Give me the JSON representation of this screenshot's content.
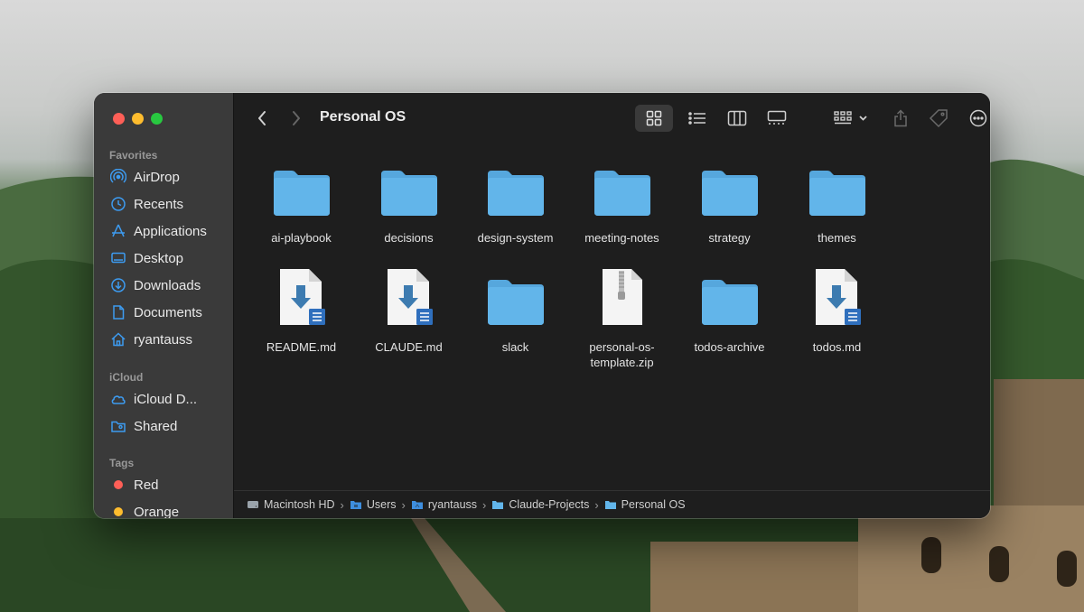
{
  "window": {
    "title": "Personal OS"
  },
  "sidebar": {
    "favorites_heading": "Favorites",
    "favorites": [
      {
        "label": "AirDrop",
        "icon": "airdrop-icon"
      },
      {
        "label": "Recents",
        "icon": "clock-icon"
      },
      {
        "label": "Applications",
        "icon": "applications-icon"
      },
      {
        "label": "Desktop",
        "icon": "desktop-icon"
      },
      {
        "label": "Downloads",
        "icon": "download-icon"
      },
      {
        "label": "Documents",
        "icon": "document-icon"
      },
      {
        "label": "ryantauss",
        "icon": "home-icon"
      }
    ],
    "icloud_heading": "iCloud",
    "icloud": [
      {
        "label": "iCloud D...",
        "icon": "cloud-icon"
      },
      {
        "label": "Shared",
        "icon": "shared-folder-icon"
      }
    ],
    "tags_heading": "Tags",
    "tags": [
      {
        "label": "Red",
        "color": "#ff5f57"
      },
      {
        "label": "Orange",
        "color": "#febc2e"
      }
    ]
  },
  "items": [
    {
      "name": "ai-playbook",
      "type": "folder"
    },
    {
      "name": "decisions",
      "type": "folder"
    },
    {
      "name": "design-system",
      "type": "folder"
    },
    {
      "name": "meeting-notes",
      "type": "folder"
    },
    {
      "name": "strategy",
      "type": "folder"
    },
    {
      "name": "themes",
      "type": "folder"
    },
    {
      "name": "README.md",
      "type": "markdown"
    },
    {
      "name": "CLAUDE.md",
      "type": "markdown"
    },
    {
      "name": "slack",
      "type": "folder"
    },
    {
      "name": "personal-os-template.zip",
      "type": "zip",
      "zip_label": "ZIP"
    },
    {
      "name": "todos-archive",
      "type": "folder"
    },
    {
      "name": "todos.md",
      "type": "markdown"
    }
  ],
  "pathbar": [
    {
      "label": "Macintosh HD",
      "icon": "disk-icon"
    },
    {
      "label": "Users",
      "icon": "folder-icon"
    },
    {
      "label": "ryantauss",
      "icon": "folder-icon"
    },
    {
      "label": "Claude-Projects",
      "icon": "folder-icon"
    },
    {
      "label": "Personal OS",
      "icon": "folder-icon"
    }
  ],
  "colors": {
    "folder": "#62b5ea",
    "folder_tab": "#56a7dd",
    "accent": "#3e8ede"
  }
}
